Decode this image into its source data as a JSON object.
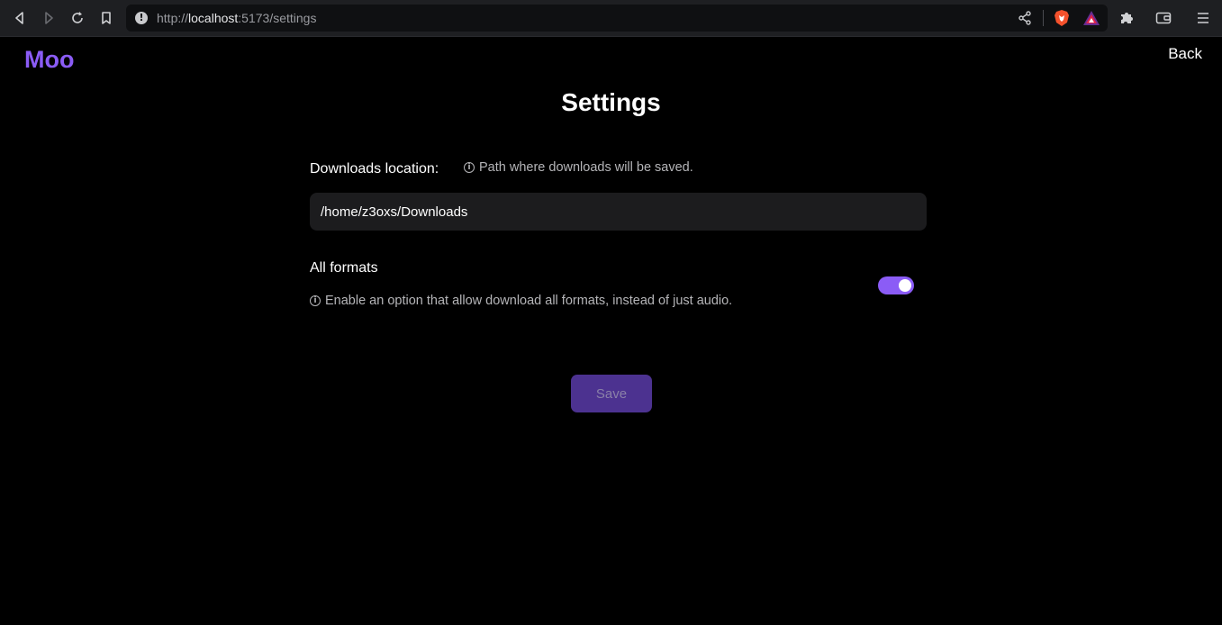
{
  "browser": {
    "url_scheme": "http://",
    "url_host": "localhost",
    "url_rest": ":5173/settings",
    "info_glyph": "!"
  },
  "app": {
    "logo": "Moo",
    "back_label": "Back",
    "title": "Settings",
    "accent_color": "#8b5cf6"
  },
  "downloads": {
    "label": "Downloads location:",
    "hint": "Path where downloads will be saved.",
    "value": "/home/z3oxs/Downloads"
  },
  "formats": {
    "label": "All formats",
    "hint": "Enable an option that allow download all formats, instead of just audio.",
    "enabled": true
  },
  "actions": {
    "save_label": "Save"
  },
  "icons": {
    "info": "ⓘ"
  }
}
